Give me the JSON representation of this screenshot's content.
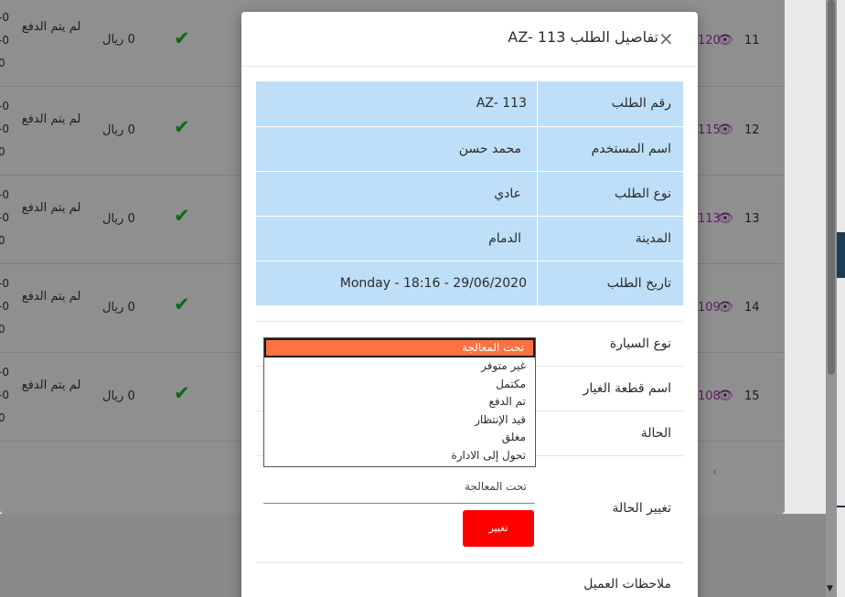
{
  "background_table": {
    "rows": [
      {
        "num": "11",
        "link": "120",
        "payment": "لم يتم الدفع",
        "amount": "0 ريال",
        "cut": [
          "-0",
          "-0",
          "0"
        ]
      },
      {
        "num": "12",
        "link": "115",
        "payment": "لم يتم الدفع",
        "amount": "0 ريال",
        "cut": [
          "-0",
          "-0",
          "0"
        ]
      },
      {
        "num": "13",
        "link": "113",
        "payment": "لم يتم الدفع",
        "amount": "0 ريال",
        "cut": [
          "-0",
          "-0",
          "0"
        ]
      },
      {
        "num": "14",
        "link": "109",
        "payment": "لم يتم الدفع",
        "amount": "0 ريال",
        "cut": [
          "-0",
          "-0",
          "0"
        ]
      },
      {
        "num": "15",
        "link": "108",
        "payment": "لم يتم الدفع",
        "amount": "0 ريال",
        "cut": [
          "-0",
          "-0",
          "0"
        ]
      }
    ],
    "pager_label": "‹"
  },
  "modal": {
    "title": "تفاصيل الطلب AZ- 113",
    "close_label": "×",
    "details": [
      {
        "label": "رقم الطلب",
        "value": "AZ- 113"
      },
      {
        "label": "اسم المستخدم",
        "value": "محمد حسن"
      },
      {
        "label": "نوع الطلب",
        "value": "عادي"
      },
      {
        "label": "المدينة",
        "value": "الدمام"
      },
      {
        "label": "تاريخ الطلب",
        "value": "Monday - 18:16 - 29/06/2020"
      }
    ],
    "car_type_label": "نوع السيارة",
    "part_name_label": "اسم قطعة الغيار",
    "status_label": "الحالة",
    "change_status_label": "تغيير الحالة",
    "change_status_value": "تحت المعالجة",
    "change_button": "تغيير",
    "customer_notes_label": "ملاحظات العميل"
  },
  "status_dropdown": {
    "options": [
      "تحت المعالجة",
      "غير متوفر",
      "مكتمل",
      "تم الدفع",
      "قيد الإنتظار",
      "مغلق",
      "تحول إلى الادارة"
    ],
    "selected": "تحت المعالجة"
  },
  "icons": {
    "check": "check-icon",
    "eye": "eye-icon",
    "close": "close-icon"
  },
  "colors": {
    "info_bg": "#bfdff8",
    "button_bg": "#ff0000",
    "selected_option": "#ff7043",
    "check": "#0a6a12"
  }
}
